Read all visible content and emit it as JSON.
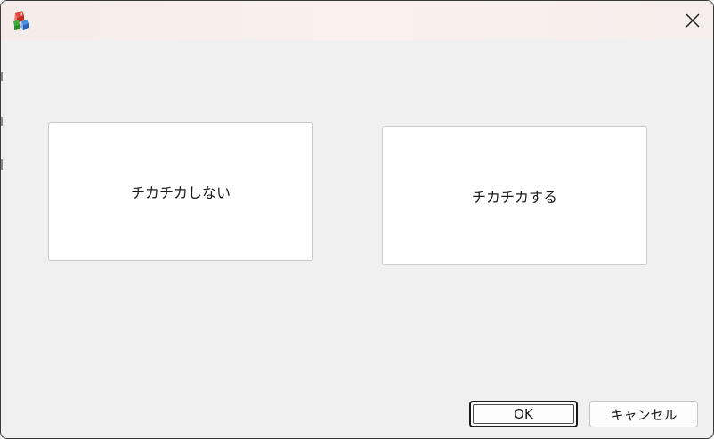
{
  "window": {
    "icon": "blocks-app-icon",
    "close_icon": "close-icon"
  },
  "choices": {
    "no_flicker": "チカチカしない",
    "flicker": "チカチカする"
  },
  "buttons": {
    "ok_label": "OK",
    "cancel_label": "キャンセル"
  },
  "colors": {
    "titlebar": "#f5ecea",
    "background": "#f0f0f0",
    "card": "#ffffff"
  }
}
